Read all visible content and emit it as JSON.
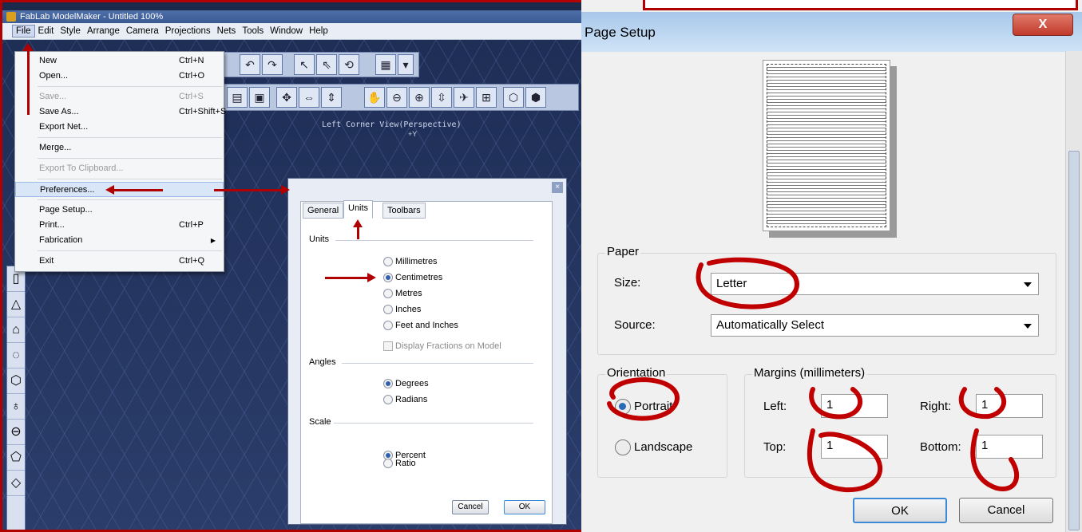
{
  "app": {
    "title": "FabLab ModelMaker - Untitled 100%",
    "menu": [
      "File",
      "Edit",
      "Style",
      "Arrange",
      "Camera",
      "Projections",
      "Nets",
      "Tools",
      "Window",
      "Help"
    ],
    "view_label": "Left Corner View(Perspective)",
    "axis_label": "+Y"
  },
  "file_menu": {
    "items": [
      {
        "label": "New",
        "shortcut": "Ctrl+N"
      },
      {
        "label": "Open...",
        "shortcut": "Ctrl+O"
      },
      {
        "label": "Save...",
        "shortcut": "Ctrl+S"
      },
      {
        "label": "Save As...",
        "shortcut": "Ctrl+Shift+S"
      },
      {
        "label": "Export Net..."
      },
      {
        "label": "Merge..."
      },
      {
        "label": "Export To Clipboard..."
      },
      {
        "label": "Preferences..."
      },
      {
        "label": "Page Setup..."
      },
      {
        "label": "Print...",
        "shortcut": "Ctrl+P"
      },
      {
        "label": "Fabrication"
      },
      {
        "label": "Exit",
        "shortcut": "Ctrl+Q"
      }
    ]
  },
  "preferences": {
    "tabs": [
      "General",
      "Units",
      "Toolbars"
    ],
    "units_group": "Units",
    "units": [
      "Millimetres",
      "Centimetres",
      "Metres",
      "Inches",
      "Feet and Inches"
    ],
    "selected_unit": "Centimetres",
    "fractions": "Display Fractions on Model",
    "angles_group": "Angles",
    "angles": [
      "Degrees",
      "Radians"
    ],
    "scale_group": "Scale",
    "scale": [
      "Percent",
      "Ratio"
    ],
    "cancel": "Cancel",
    "ok": "OK"
  },
  "page_setup": {
    "title": "Page Setup",
    "close": "X",
    "paper_group": "Paper",
    "size_label": "Size:",
    "size_value": "Letter",
    "source_label": "Source:",
    "source_value": "Automatically Select",
    "orientation_group": "Orientation",
    "portrait": "Portrait",
    "landscape": "Landscape",
    "margins_group": "Margins (millimeters)",
    "left_label": "Left:",
    "left_value": "1",
    "right_label": "Right:",
    "right_value": "1",
    "top_label": "Top:",
    "top_value": "1",
    "bottom_label": "Bottom:",
    "bottom_value": "1",
    "ok": "OK",
    "cancel": "Cancel"
  },
  "colors": {
    "annotation": "#b00000",
    "accent": "#2a6ab8"
  }
}
